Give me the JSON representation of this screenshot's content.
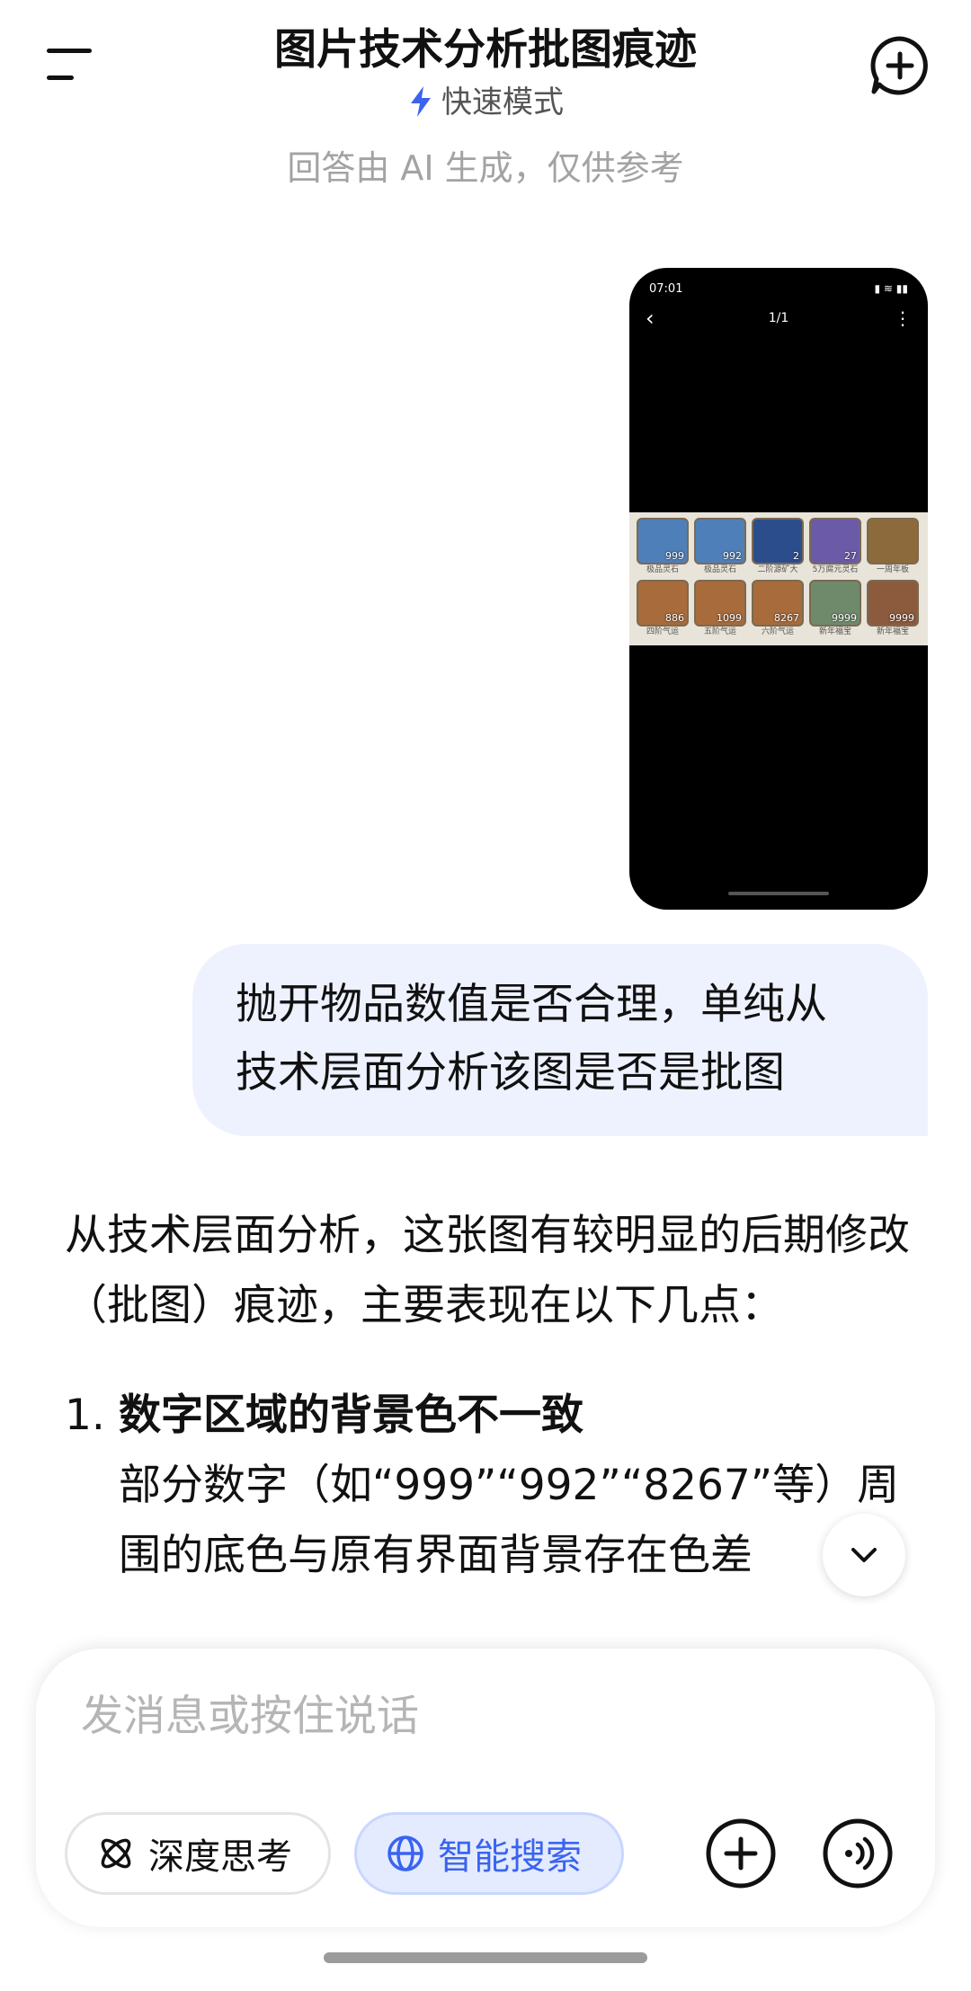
{
  "header": {
    "title": "图片技术分析批图痕迹",
    "mode_label": "快速模式",
    "notice": "回答由 AI 生成，仅供参考"
  },
  "attachment": {
    "status_time": "07:01",
    "page_indicator": "1/1",
    "rows": [
      [
        {
          "count": "999",
          "name": "极品灵石",
          "color": "#4f7fb8"
        },
        {
          "count": "992",
          "name": "极品灵石",
          "color": "#4f7fb8"
        },
        {
          "count": "2",
          "name": "二阶源矿大",
          "color": "#2c4d8c"
        },
        {
          "count": "27",
          "name": "5万腐元灵石",
          "color": "#6b5aa8"
        },
        {
          "count": "",
          "name": "一周年板",
          "color": "#8c6a3c"
        }
      ],
      [
        {
          "count": "886",
          "name": "四阶气运",
          "color": "#a86b3c"
        },
        {
          "count": "1099",
          "name": "五阶气运",
          "color": "#a86b3c"
        },
        {
          "count": "8267",
          "name": "六阶气运",
          "color": "#a86b3c"
        },
        {
          "count": "9999",
          "name": "新年福宝",
          "color": "#6f8a6a"
        },
        {
          "count": "9999",
          "name": "新年福宝",
          "color": "#8c5a3c"
        }
      ]
    ]
  },
  "user_message": {
    "line1": "抛开物品数值是否合理，单纯从",
    "line2": "技术层面分析该图是否是批图"
  },
  "answer": {
    "intro": "从技术层面分析，这张图有较明显的后期修改（批图）痕迹，主要表现在以下几点：",
    "items": [
      {
        "number": "1.",
        "heading": "数字区域的背景色不一致",
        "body": "部分数字（如“999”“992”“8267”等）周围的底色与原有界面背景存在色差"
      }
    ]
  },
  "composer": {
    "placeholder": "发消息或按住说话",
    "deep_think_label": "深度思考",
    "smart_search_label": "智能搜索"
  },
  "colors": {
    "accent": "#3a64f0",
    "bubble": "#eef2fe"
  }
}
